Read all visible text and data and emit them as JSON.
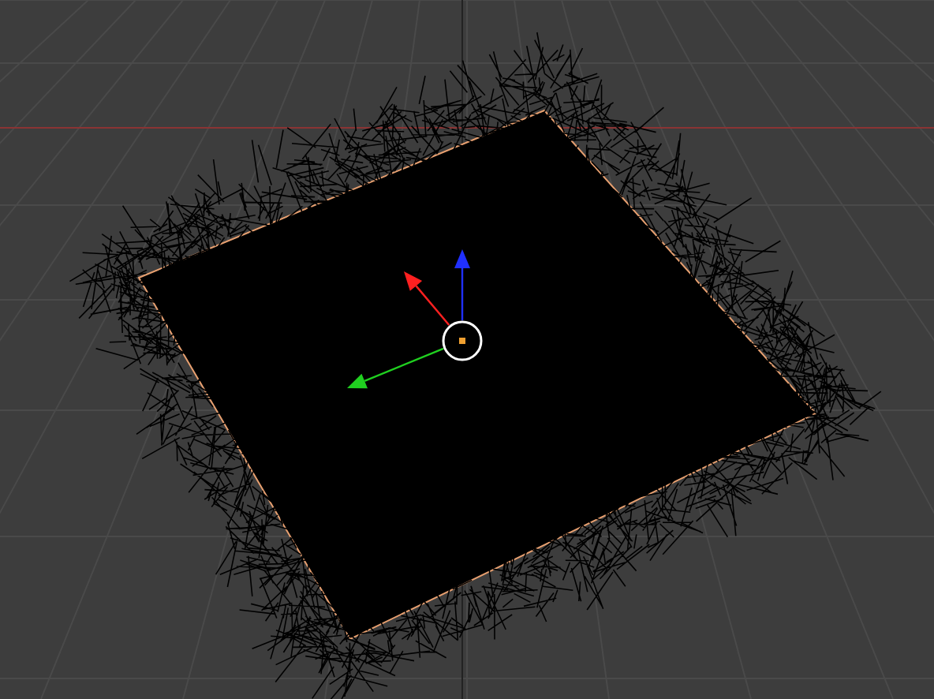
{
  "viewport": {
    "gizmo": {
      "axes": [
        {
          "kind": "arrow",
          "color": "#ff2020"
        },
        {
          "kind": "arrow",
          "color": "#2030ff"
        },
        {
          "kind": "arrow",
          "color": "#20d020"
        }
      ]
    }
  }
}
